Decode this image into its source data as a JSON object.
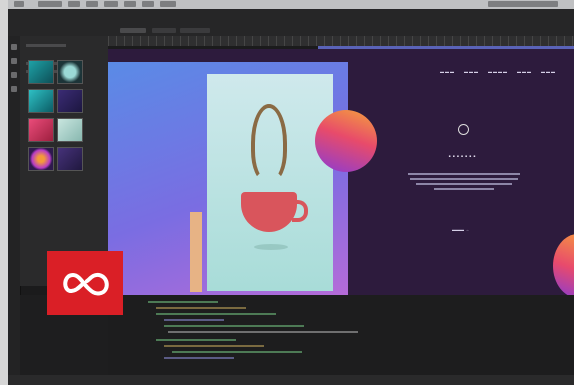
{
  "app": {
    "brand_color": "#da1f26",
    "logo_icon": "adobe-creative-cloud-icon"
  },
  "canvas": {
    "accent_gradient": [
      "#5a8be6",
      "#7a6de2",
      "#b56bd8"
    ],
    "background": "#2d1b3d",
    "orb_gradient": [
      "#f4a23c",
      "#e84b6a",
      "#8b3bd4"
    ]
  }
}
